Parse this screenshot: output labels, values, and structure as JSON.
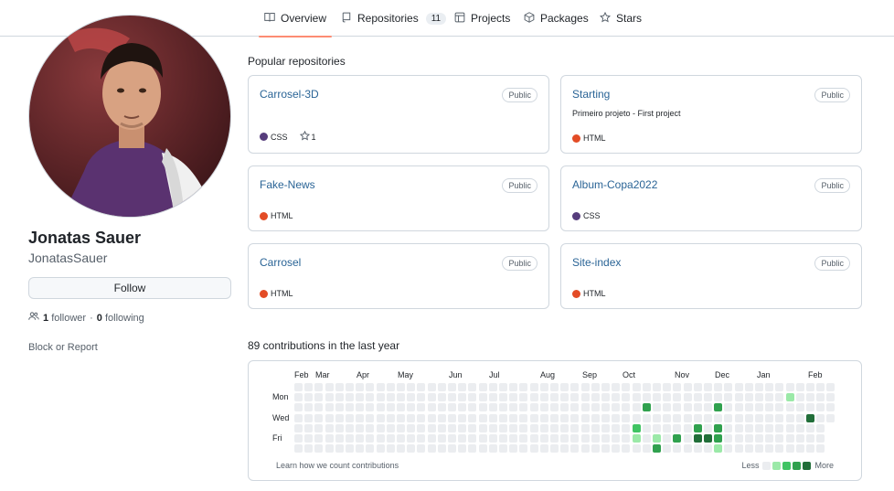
{
  "nav": {
    "tabs": [
      {
        "label": "Overview",
        "icon": "book-icon",
        "active": true
      },
      {
        "label": "Repositories",
        "icon": "repo-icon",
        "count": "11"
      },
      {
        "label": "Projects",
        "icon": "table-icon"
      },
      {
        "label": "Packages",
        "icon": "package-icon"
      },
      {
        "label": "Stars",
        "icon": "star-icon"
      }
    ]
  },
  "profile": {
    "name": "Jonatas Sauer",
    "login": "JonatasSauer",
    "follow_label": "Follow",
    "followers_count": "1",
    "followers_label": "follower",
    "separator": "·",
    "following_count": "0",
    "following_label": "following",
    "block_label": "Block or Report"
  },
  "popular": {
    "title": "Popular repositories",
    "repos": [
      {
        "name": "Carrosel-3D",
        "visibility": "Public",
        "description": "",
        "language": "CSS",
        "lang_color": "#563d7c",
        "stars": "1"
      },
      {
        "name": "Starting",
        "visibility": "Public",
        "description": "Primeiro projeto - First project",
        "language": "HTML",
        "lang_color": "#e34c26"
      },
      {
        "name": "Fake-News",
        "visibility": "Public",
        "description": "",
        "language": "HTML",
        "lang_color": "#e34c26"
      },
      {
        "name": "Album-Copa2022",
        "visibility": "Public",
        "description": "",
        "language": "CSS",
        "lang_color": "#563d7c"
      },
      {
        "name": "Carrosel",
        "visibility": "Public",
        "description": "",
        "language": "HTML",
        "lang_color": "#e34c26"
      },
      {
        "name": "Site-index",
        "visibility": "Public",
        "description": "",
        "language": "HTML",
        "lang_color": "#e34c26"
      }
    ]
  },
  "contributions": {
    "title": "89 contributions in the last year",
    "months": [
      "Feb",
      "Mar",
      "Apr",
      "May",
      "Jun",
      "Jul",
      "Aug",
      "Sep",
      "Oct",
      "Nov",
      "Dec",
      "Jan",
      "Feb"
    ],
    "days": [
      "Mon",
      "Wed",
      "Fri"
    ],
    "learn_label": "Learn how we count contributions",
    "less_label": "Less",
    "more_label": "More",
    "colors": [
      "#ebedf0",
      "#9be9a8",
      "#40c463",
      "#30a14e",
      "#216e39"
    ],
    "levels": [
      {
        "week": 34,
        "day": 2,
        "level": 3
      },
      {
        "week": 33,
        "day": 4,
        "level": 2
      },
      {
        "week": 33,
        "day": 5,
        "level": 1
      },
      {
        "week": 33,
        "day": 7,
        "level": 1
      },
      {
        "week": 35,
        "day": 5,
        "level": 1
      },
      {
        "week": 35,
        "day": 6,
        "level": 3
      },
      {
        "week": 37,
        "day": 5,
        "level": 3
      },
      {
        "week": 39,
        "day": 4,
        "level": 3
      },
      {
        "week": 39,
        "day": 5,
        "level": 4
      },
      {
        "week": 40,
        "day": 5,
        "level": 4
      },
      {
        "week": 41,
        "day": 2,
        "level": 3
      },
      {
        "week": 41,
        "day": 4,
        "level": 3
      },
      {
        "week": 41,
        "day": 5,
        "level": 3
      },
      {
        "week": 41,
        "day": 6,
        "level": 1
      },
      {
        "week": 48,
        "day": 1,
        "level": 1
      },
      {
        "week": 50,
        "day": 3,
        "level": 4
      }
    ]
  }
}
